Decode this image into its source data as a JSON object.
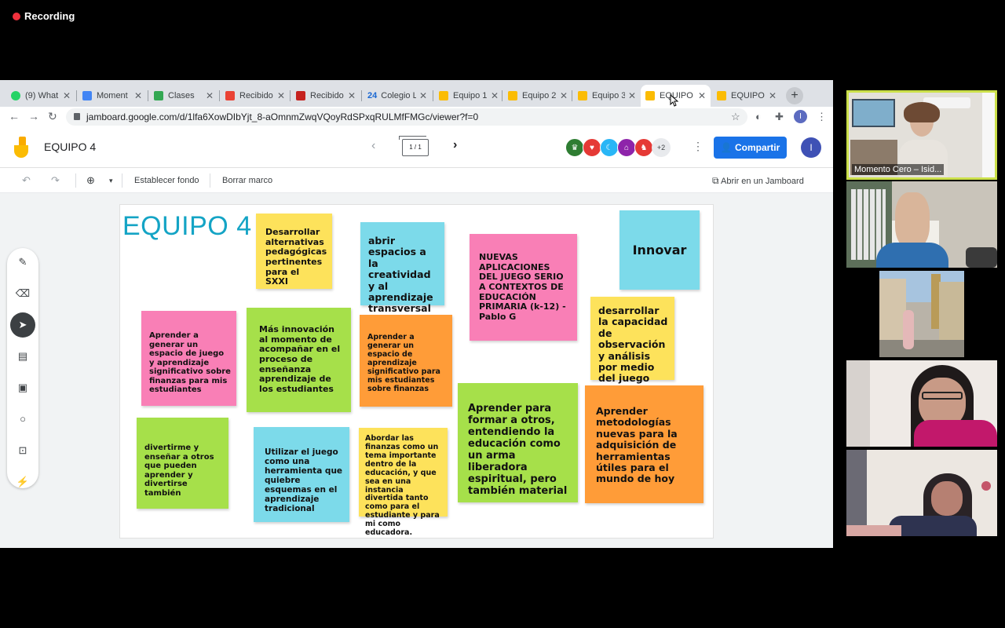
{
  "recording": {
    "label": "Recording"
  },
  "browser": {
    "tabs": [
      {
        "label": "(9) What",
        "color": "#25d366"
      },
      {
        "label": "Moment",
        "color": "#4285f4"
      },
      {
        "label": "Clases",
        "color": "#34a853"
      },
      {
        "label": "Recibido",
        "color": "#ea4335"
      },
      {
        "label": "Recibido",
        "color": "#c5221f"
      },
      {
        "label": "Colegio L",
        "color": "#1967d2"
      },
      {
        "label": "Equipo 1",
        "color": "#fbbc04"
      },
      {
        "label": "Equipo 2",
        "color": "#fbbc04"
      },
      {
        "label": "Equipo 3",
        "color": "#fbbc04"
      },
      {
        "label": "EQUIPO",
        "color": "#fbbc04"
      },
      {
        "label": "EQUIPO",
        "color": "#fbbc04"
      }
    ],
    "tab_prefix_24": "24",
    "url": "jamboard.google.com/d/1lfa6XowDIbYjt_8-aOmnmZwqVQoyRdSPxqRULMfFMGc/viewer?f=0",
    "profile_initial": "I"
  },
  "app": {
    "title": "EQUIPO 4",
    "frame_indicator": "1 / 1",
    "more_collaborators": "+2",
    "share_label": "Compartir",
    "user_initial": "I"
  },
  "toolbar": {
    "set_background": "Establecer fondo",
    "clear_frame": "Borrar marco",
    "open_in_jamboard": "Abrir en un Jamboard"
  },
  "board": {
    "title": "EQUIPO 4",
    "notes": [
      {
        "text": "Desarrollar alternativas pedagógicas pertinentes para el SXXI",
        "color": "#fde25b"
      },
      {
        "text": "abrir espacios a la creatividad y al aprendizaje transversal",
        "color": "#7cdaea"
      },
      {
        "text": "NUEVAS APLICACIONES DEL JUEGO SERIO A CONTEXTOS DE EDUCACIÓN PRIMARIA (k-12) -Pablo G",
        "color": "#f97fb6"
      },
      {
        "text": "Innovar",
        "color": "#7cdaea"
      },
      {
        "text": "Aprender a generar un espacio de juego y aprendizaje significativo sobre finanzas para mis estudiantes",
        "color": "#f97fb6"
      },
      {
        "text": "Más innovación al momento de acompañar en el proceso de enseñanza aprendizaje de los estudiantes",
        "color": "#a6e04a"
      },
      {
        "text": "Aprender a generar un espacio de aprendizaje significativo para mis estudiantes sobre finanzas",
        "color": "#ff9c38"
      },
      {
        "text": "desarrollar la capacidad de observación y análisis por medio del juego",
        "color": "#fde25b"
      },
      {
        "text": "Aprender para formar a otros, entendiendo la educación como un arma liberadora espiritual, pero también material",
        "color": "#a6e04a"
      },
      {
        "text": "Aprender metodologías nuevas para la adquisición de herramientas útiles para el mundo de hoy",
        "color": "#ff9c38"
      },
      {
        "text": "divertirme y enseñar a otros que pueden aprender y divertirse también",
        "color": "#a6e04a"
      },
      {
        "text": "Utilizar el juego como una herramienta que quiebre esquemas en el aprendizaje tradicional",
        "color": "#7cdaea"
      },
      {
        "text": "Abordar las finanzas como un tema importante dentro de la educación, y que sea en una instancia divertida tanto como para el estudiante y para mi como educadora.",
        "color": "#fde25b"
      }
    ]
  },
  "participants": [
    {
      "name": "Momento Cero – Isid..."
    }
  ]
}
